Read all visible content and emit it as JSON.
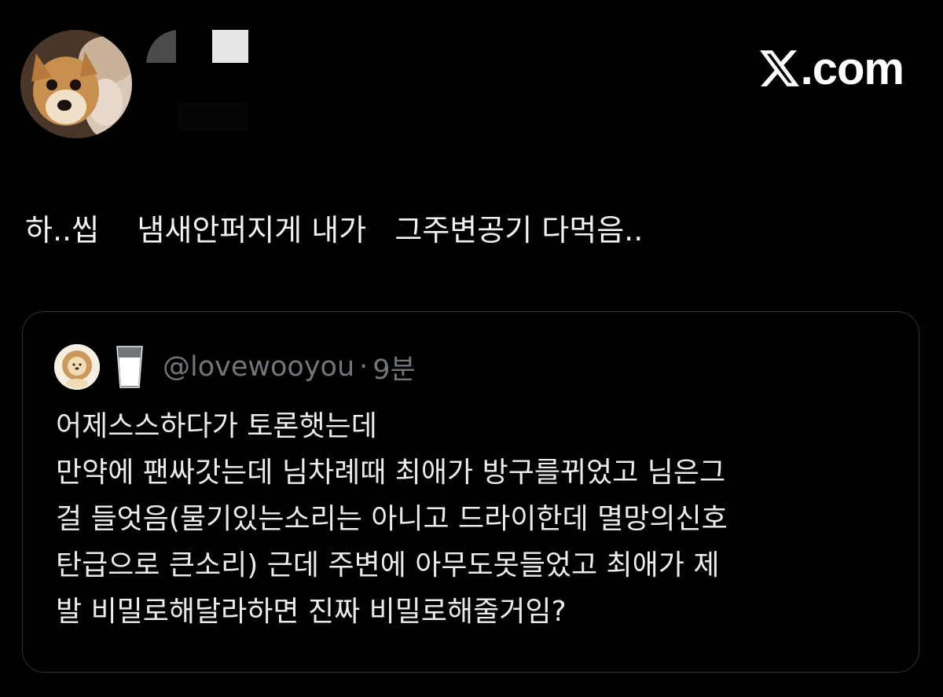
{
  "brand": {
    "text": ".com"
  },
  "tweet": {
    "text": "하..씹    냄새안퍼지게 내가   그주변공기 다먹음.."
  },
  "quote": {
    "handle": "@lovewooyou",
    "separator": "·",
    "time": "9분",
    "emoji_icon": "milk-glass-icon",
    "lines": [
      "어제스스하다가 토론햇는데",
      "만약에 팬싸갓는데 님차례때 최애가 방구를뀌었고 님은그",
      "걸 들엇음(물기있는소리는 아니고 드라이한데 멸망의신호",
      "탄급으로 큰소리) 근데 주변에 아무도못들었고 최애가 제",
      "발 비밀로해달라하면 진짜 비밀로해줄거임?"
    ]
  },
  "colors": {
    "background": "#000000",
    "text_primary": "#f2f2f2",
    "text_secondary": "#71767b",
    "border": "#2f3336"
  }
}
